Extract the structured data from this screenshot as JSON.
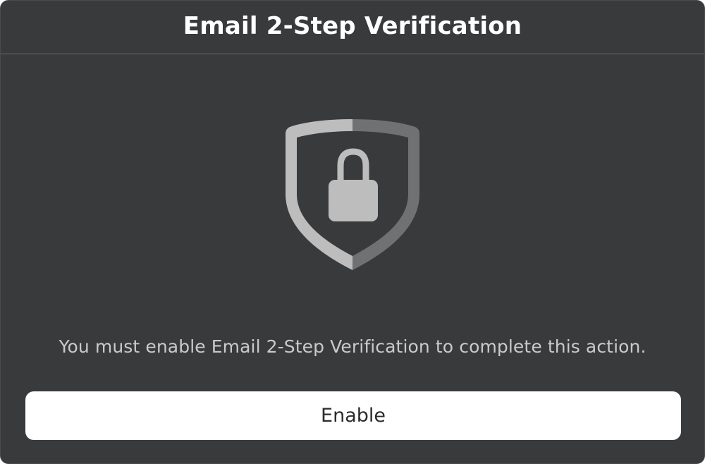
{
  "modal": {
    "title": "Email 2-Step Verification",
    "icon": "shield-lock-icon",
    "message": "You must enable Email 2-Step Verification to complete this action.",
    "enable_label": "Enable"
  },
  "colors": {
    "modal_background": "#393a3c",
    "title_text": "#ffffff",
    "message_text": "#c9cacc",
    "button_background": "#ffffff",
    "button_text": "#2b2c2e",
    "shield_light": "#bdbdbd",
    "shield_dark": "#6f7173"
  }
}
